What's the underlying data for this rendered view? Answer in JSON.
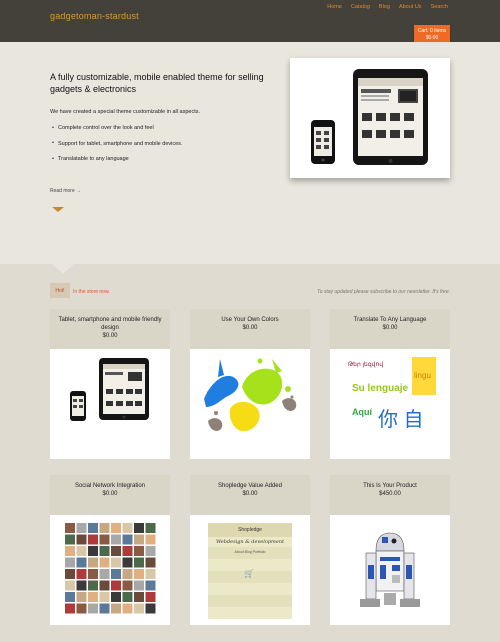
{
  "header": {
    "brand": "gadgetoman-stardust",
    "nav": [
      "Home",
      "Catalog",
      "Blog",
      "About Us",
      "Search"
    ],
    "cart_line1": "Cart: 0 items",
    "cart_line2": "$0.00",
    "cart_color": "#ee6a25"
  },
  "hero": {
    "title": "A fully customizable, mobile enabled theme for selling gadgets & electronics",
    "lead": "We have created a special theme customizable in all aspects.",
    "bullets": [
      "Complete control over the look and feel",
      "Support for tablet, smartphone and mobile devices.",
      "Translatable to any language"
    ],
    "read_more": "Read more →"
  },
  "store": {
    "hot_badge": "Hot!",
    "heading": "In the store now.",
    "newsletter": "To stay updated please subscribe to our newsletter. It's free."
  },
  "products": [
    {
      "name": "Tablet, smartphone and mobile friendly design",
      "price": "$0.00"
    },
    {
      "name": "Use Your Own Colors",
      "price": "$0.00"
    },
    {
      "name": "Translate To Any Language",
      "price": "$0.00"
    },
    {
      "name": "Social Network Integration",
      "price": "$0.00"
    },
    {
      "name": "Shopledge Value Added",
      "price": "$0.00"
    },
    {
      "name": "This Is Your Product",
      "price": "$450.00"
    }
  ],
  "translate_image": {
    "line1": "Թեր լեզվով",
    "line2": "Su lenguaje",
    "line3": "Aquí",
    "cjk": "你 自",
    "side": "lingu"
  },
  "shopledge_image": {
    "title": "Shopledge",
    "script": "Webdesign & development",
    "menu": "About   Blog   Portfolio"
  }
}
